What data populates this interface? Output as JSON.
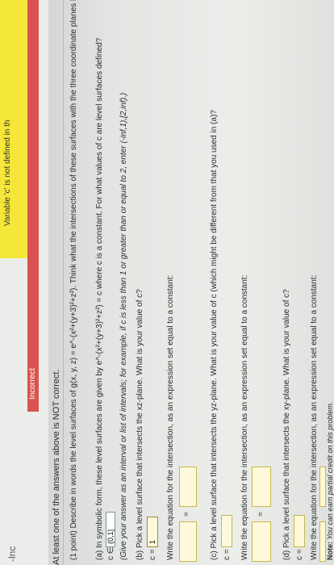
{
  "header": {
    "lnc": "-lnc",
    "incorrect": "Incorrect",
    "variable_msg": "Variable 'c' is not defined in th"
  },
  "summary": "At least one of the answers above is NOT correct.",
  "question": {
    "intro": "(1 point) Describe in words the level surfaces of g(x, y, z) = e^-(x²+(y+3)²+z²). Think what the intersections of these surfaces with the three coordinate planes look like.",
    "a_label": "(a) In symbolic form, these level surfaces are given by e^-(x²+(y+3)²+z²) = c where c is a constant. For what values of c are level surfaces defined?",
    "a_c_prefix": "c ∈",
    "a_value": "(0,1]",
    "a_hint": "(Give your answer as an interval or list of intervals; for example, if c is less than 1 or greater than or equal to 2, enter (-inf,1),[2,inf).)",
    "b_label": "(b) Pick a level surface that intersects the xz-plane. What is your value of c?",
    "b_c_prefix": "c =",
    "b_value": "1",
    "b_write": "Write the equation for the intersection, as an expression set equal to a constant:",
    "c_label": "(c) Pick a level surface that intersects the yz-plane. What is your value of c (which might be different from that you used in (a)?",
    "c_c_prefix": "c =",
    "c_write": "Write the equation for the intersection, as an expression set equal to a constant:",
    "d_label": "(d) Pick a level surface that intersects the xy-plane. What is your value of c?",
    "d_c_prefix": "c =",
    "d_write": "Write the equation for the intersection, as an expression set equal to a constant:",
    "eq_sign": "=",
    "note_bold": "Note:",
    "note_text": " You can earn partial credit on this problem."
  },
  "colors": {
    "incorrect": "#d9534f",
    "warning": "#f5e63a",
    "answer_box": "#fff9dc"
  }
}
